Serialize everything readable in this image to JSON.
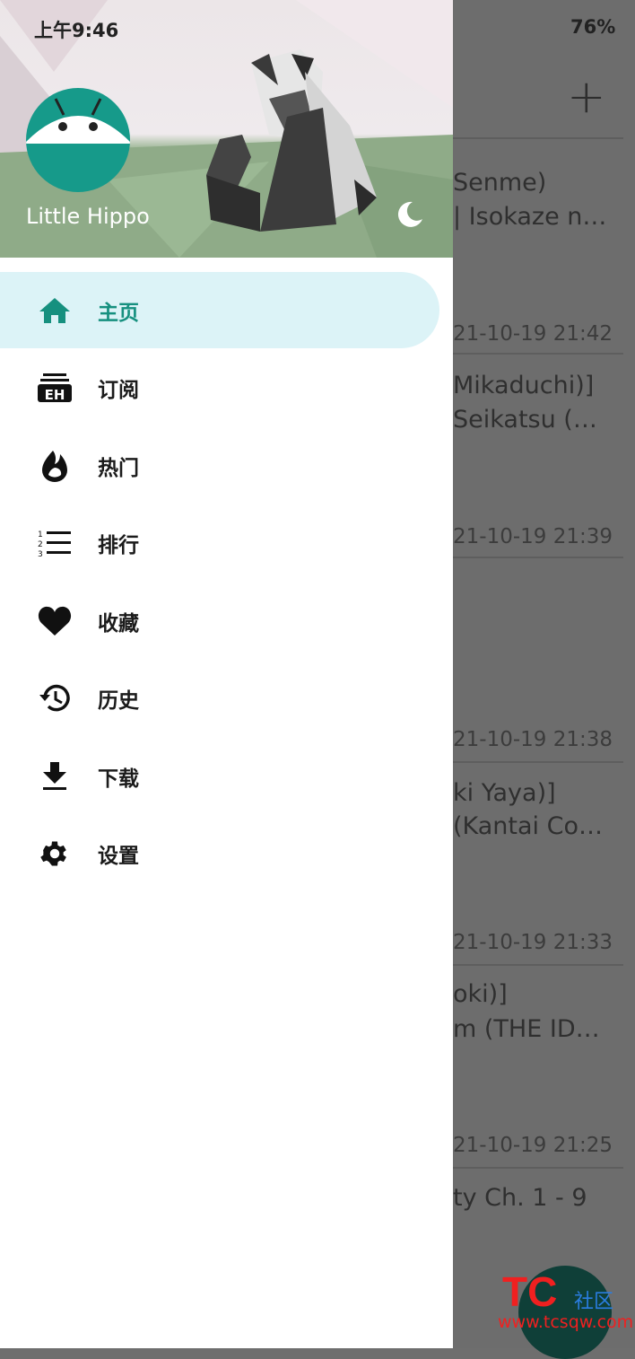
{
  "status_bar": {
    "time": "上午9:46",
    "battery": "76%"
  },
  "drawer": {
    "user_name": "Little Hippo",
    "items": [
      {
        "label": "主页",
        "icon": "home-icon",
        "active": true
      },
      {
        "label": "订阅",
        "icon": "eh-subscription-icon",
        "active": false
      },
      {
        "label": "热门",
        "icon": "fire-icon",
        "active": false
      },
      {
        "label": "排行",
        "icon": "ranking-list-icon",
        "active": false
      },
      {
        "label": "收藏",
        "icon": "heart-icon",
        "active": false
      },
      {
        "label": "历史",
        "icon": "history-icon",
        "active": false
      },
      {
        "label": "下载",
        "icon": "download-icon",
        "active": false
      },
      {
        "label": "设置",
        "icon": "gear-icon",
        "active": false
      }
    ]
  },
  "background_list": {
    "add_label": "+",
    "items": [
      {
        "line1": "Senme)",
        "line2": "| Isokaze n…",
        "date": "21-10-19 21:42"
      },
      {
        "line1": "Mikaduchi)]",
        "line2": "Seikatsu (…",
        "date": "21-10-19 21:39"
      },
      {
        "line1": "",
        "line2": "",
        "date": "21-10-19 21:38"
      },
      {
        "line1": "ki Yaya)]",
        "line2": "(Kantai Co…",
        "date": "21-10-19 21:33"
      },
      {
        "line1": "oki)]",
        "line2": "m (THE ID…",
        "date": "21-10-19 21:25"
      },
      {
        "line1": "ty Ch. 1 - 9",
        "line2": "",
        "date": ""
      }
    ]
  },
  "watermark": {
    "logo": "TC",
    "suffix": "社区",
    "url": "www.tcsqw.com"
  },
  "colors": {
    "accent": "#16907f",
    "active_bg": "#dcf3f7",
    "scrim": "#6d6d6d"
  }
}
